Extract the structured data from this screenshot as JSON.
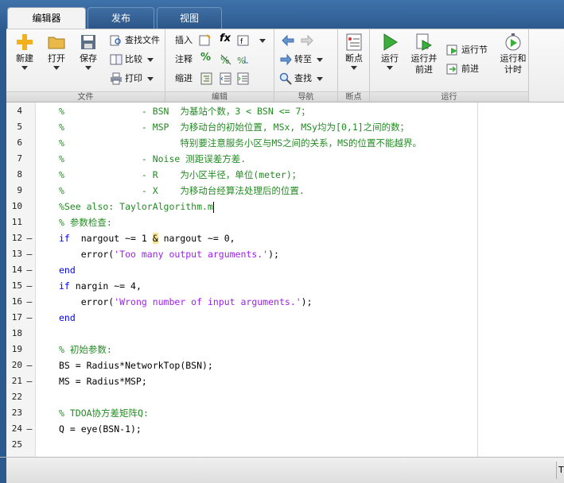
{
  "tabs": [
    {
      "label": "编辑器",
      "active": true
    },
    {
      "label": "发布",
      "active": false
    },
    {
      "label": "视图",
      "active": false
    }
  ],
  "ribbon": {
    "file": {
      "new_label": "新建",
      "open_label": "打开",
      "save_label": "保存",
      "find_files_label": "查找文件",
      "compare_label": "比较",
      "print_label": "打印",
      "group_label": "文件"
    },
    "edit": {
      "insert_label": "插入",
      "comment_label": "注释",
      "indent_label": "缩进",
      "fx_label": "fx",
      "percent_label": "%",
      "group_label": "编辑"
    },
    "navigate": {
      "goto_label": "转至",
      "find_label": "查找",
      "group_label": "导航"
    },
    "breakpoints": {
      "breakpoint_label": "断点",
      "group_label": "断点"
    },
    "run": {
      "run_label": "运行",
      "run_advance_label1": "运行并",
      "run_advance_label2": "前进",
      "run_section_label": "运行节",
      "advance_label": "前进",
      "run_time_label1": "运行和",
      "run_time_label2": "计时",
      "group_label": "运行"
    }
  },
  "editor": {
    "lines": [
      {
        "n": "4",
        "mark": "",
        "segs": [
          {
            "t": "%              - BSN  为基站个数，3 < BSN <= 7；",
            "c": "com"
          }
        ]
      },
      {
        "n": "5",
        "mark": "",
        "segs": [
          {
            "t": "%              - MSP  为移动台的初始位置, MSx, MSy均为[0,1]之间的数；",
            "c": "com"
          }
        ]
      },
      {
        "n": "6",
        "mark": "",
        "segs": [
          {
            "t": "%                     特别要注意服务小区与MS之间的关系，MS的位置不能越界。",
            "c": "com"
          }
        ]
      },
      {
        "n": "7",
        "mark": "",
        "segs": [
          {
            "t": "%              - Noise 测距误差方差.",
            "c": "com"
          }
        ]
      },
      {
        "n": "8",
        "mark": "",
        "segs": [
          {
            "t": "%              - R    为小区半径，单位(meter)；",
            "c": "com"
          }
        ]
      },
      {
        "n": "9",
        "mark": "",
        "segs": [
          {
            "t": "%              - X    为移动台经算法处理后的位置.",
            "c": "com"
          }
        ]
      },
      {
        "n": "10",
        "mark": "",
        "segs": [
          {
            "t": "%See also: TaylorAlgorithm.m",
            "c": "com"
          }
        ],
        "cursor": true
      },
      {
        "n": "11",
        "mark": "",
        "segs": [
          {
            "t": "% 参数检查:",
            "c": "com"
          }
        ]
      },
      {
        "n": "12",
        "mark": "—",
        "segs": [
          {
            "t": "if",
            "c": "kw"
          },
          {
            "t": "  nargout ~= 1 ",
            "c": "txt"
          },
          {
            "t": "&",
            "c": "amp"
          },
          {
            "t": " nargout ~= 0,",
            "c": "txt"
          }
        ]
      },
      {
        "n": "13",
        "mark": "—",
        "segs": [
          {
            "t": "    error(",
            "c": "txt"
          },
          {
            "t": "'Too many output arguments.'",
            "c": "str"
          },
          {
            "t": ");",
            "c": "txt"
          }
        ]
      },
      {
        "n": "14",
        "mark": "—",
        "segs": [
          {
            "t": "end",
            "c": "kw"
          }
        ]
      },
      {
        "n": "15",
        "mark": "—",
        "segs": [
          {
            "t": "if",
            "c": "kw"
          },
          {
            "t": " nargin ~= 4,",
            "c": "txt"
          }
        ]
      },
      {
        "n": "16",
        "mark": "—",
        "segs": [
          {
            "t": "    error(",
            "c": "txt"
          },
          {
            "t": "'Wrong number of input arguments.'",
            "c": "str"
          },
          {
            "t": ");",
            "c": "txt"
          }
        ]
      },
      {
        "n": "17",
        "mark": "—",
        "segs": [
          {
            "t": "end",
            "c": "kw"
          }
        ]
      },
      {
        "n": "18",
        "mark": "",
        "segs": []
      },
      {
        "n": "19",
        "mark": "",
        "segs": [
          {
            "t": "% 初始参数:",
            "c": "com"
          }
        ]
      },
      {
        "n": "20",
        "mark": "—",
        "segs": [
          {
            "t": "BS = Radius*NetworkTop(BSN);",
            "c": "txt"
          }
        ]
      },
      {
        "n": "21",
        "mark": "—",
        "segs": [
          {
            "t": "MS = Radius*MSP;",
            "c": "txt"
          }
        ]
      },
      {
        "n": "22",
        "mark": "",
        "segs": []
      },
      {
        "n": "23",
        "mark": "",
        "segs": [
          {
            "t": "% TDOA协方差矩阵Q:",
            "c": "com"
          }
        ]
      },
      {
        "n": "24",
        "mark": "—",
        "segs": [
          {
            "t": "Q = eye(BSN-1);",
            "c": "txt"
          }
        ]
      },
      {
        "n": "25",
        "mark": "",
        "segs": []
      }
    ]
  },
  "status": {
    "cell_text": "T"
  },
  "colors": {
    "comment": "#228b22",
    "keyword": "#0000ff",
    "string": "#a020f0",
    "frame": "#2b5a8f"
  }
}
